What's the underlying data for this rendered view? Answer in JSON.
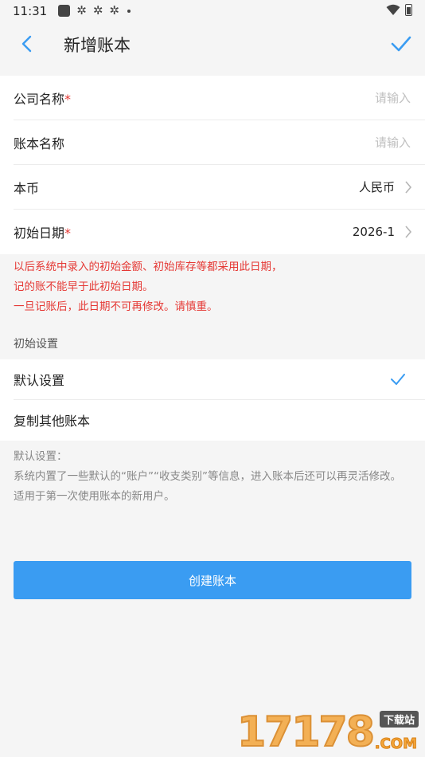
{
  "status_bar": {
    "time": "11:31"
  },
  "header": {
    "title": "新增账本",
    "back_icon": "chevron-left-icon",
    "confirm_icon": "check-icon"
  },
  "form": {
    "company_name": {
      "label": "公司名称",
      "required_mark": "*",
      "placeholder": "请输入",
      "value": ""
    },
    "book_name": {
      "label": "账本名称",
      "placeholder": "请输入",
      "value": ""
    },
    "currency": {
      "label": "本币",
      "value": "人民币"
    },
    "start_date": {
      "label": "初始日期",
      "required_mark": "*",
      "value": "2026-1"
    }
  },
  "warning": {
    "line1": "以后系统中录入的初始金额、初始库存等都采用此日期，",
    "line2": "记的账不能早于此初始日期。",
    "line3": "一旦记账后，此日期不可再修改。请慎重。"
  },
  "initial_settings": {
    "section_title": "初始设置",
    "options": [
      {
        "label": "默认设置",
        "selected": true
      },
      {
        "label": "复制其他账本",
        "selected": false
      }
    ]
  },
  "description": {
    "line1": "默认设置：",
    "line2": "系统内置了一些默认的“账户”“收支类别”等信息，进入账本后还可以再灵活修改。",
    "line3": "适用于第一次使用账本的新用户。"
  },
  "create_button": {
    "label": "创建账本"
  },
  "watermark": {
    "digits": "17178",
    "badge": "下载站",
    "suffix": ".COM"
  },
  "colors": {
    "accent": "#3a9cf2",
    "required": "#e53935",
    "warning_text": "#e53935",
    "background": "#f5f5f5"
  }
}
